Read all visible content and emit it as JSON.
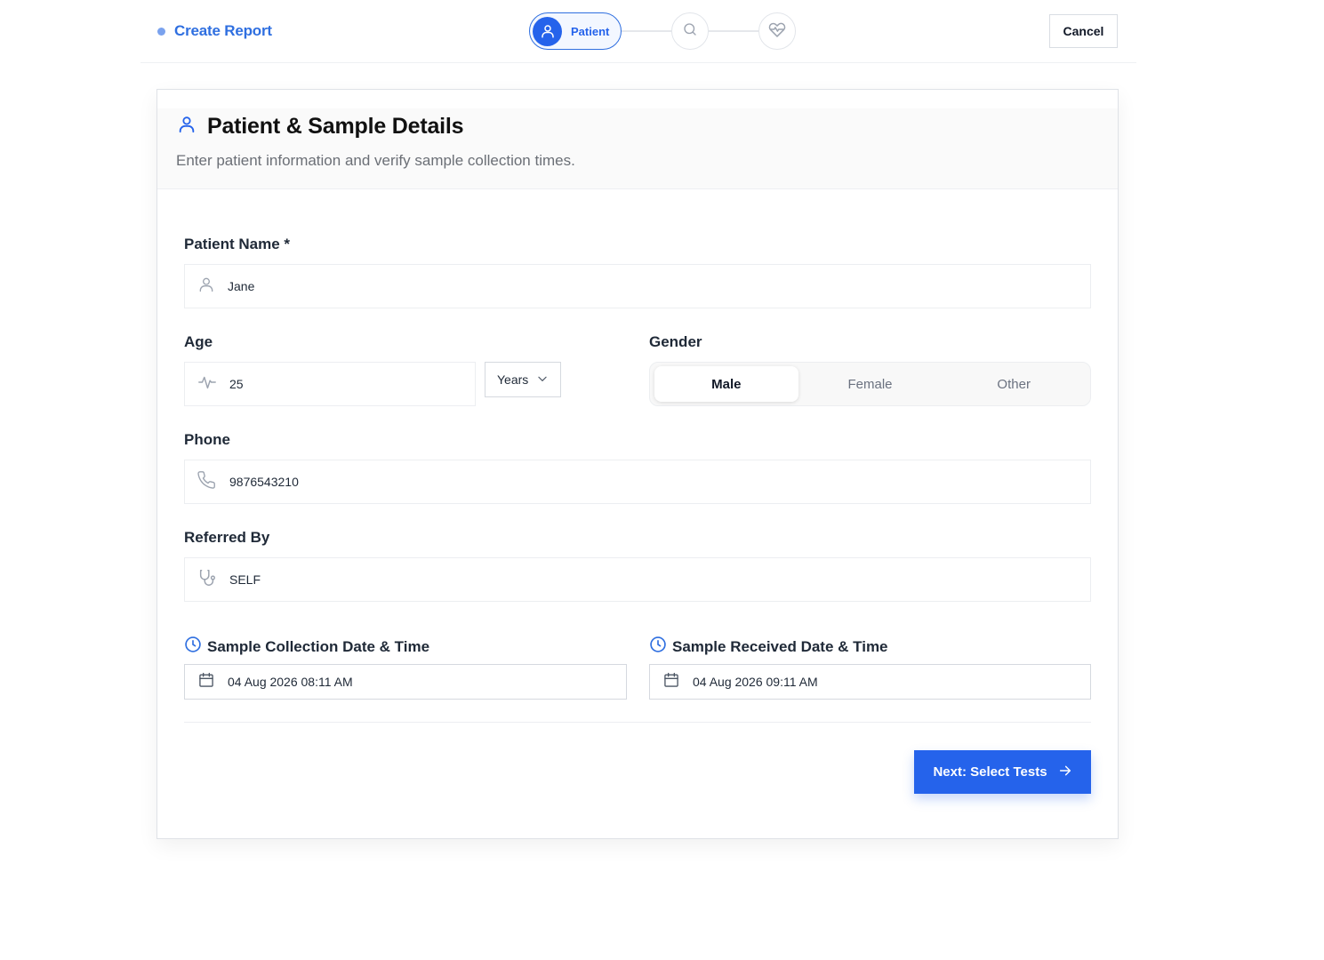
{
  "header": {
    "title": "Create Report",
    "cancel_label": "Cancel",
    "accent_color": "#2563eb",
    "steps": [
      {
        "label": "Patient",
        "icon": "user-icon",
        "state": "active"
      },
      {
        "label": "",
        "icon": "search-icon",
        "state": "inactive"
      },
      {
        "label": "",
        "icon": "heart-pulse-icon",
        "state": "inactive"
      }
    ]
  },
  "card": {
    "title": "Patient & Sample Details",
    "subtitle": "Enter patient information and verify sample collection times.",
    "title_icon": "user-icon"
  },
  "form": {
    "patient_name": {
      "label": "Patient Name *",
      "value": "Jane",
      "icon": "user-icon"
    },
    "age": {
      "label": "Age",
      "value": "25",
      "icon": "activity-icon",
      "unit": "Years"
    },
    "gender": {
      "label": "Gender",
      "options": [
        "Male",
        "Female",
        "Other"
      ],
      "selected": "Male"
    },
    "phone": {
      "label": "Phone",
      "value": "9876543210",
      "icon": "phone-icon"
    },
    "referred_by": {
      "label": "Referred By",
      "value": "SELF",
      "icon": "stethoscope-icon"
    },
    "sample_collection": {
      "label": "Sample Collection Date & Time",
      "value": "04 Aug 2026 08:11 AM",
      "icon": "calendar-icon"
    },
    "sample_received": {
      "label": "Sample Received Date & Time",
      "value": "04 Aug 2026 09:11 AM",
      "icon": "calendar-icon"
    }
  },
  "actions": {
    "next_label": "Next: Select Tests"
  }
}
